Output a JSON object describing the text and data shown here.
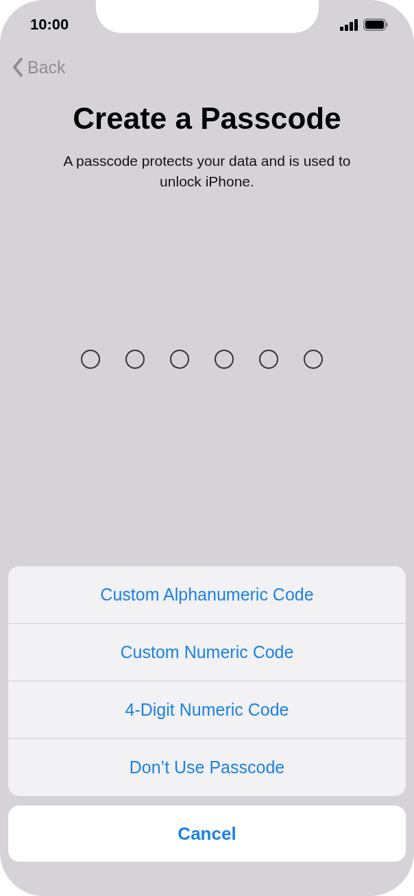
{
  "status_bar": {
    "time": "10:00"
  },
  "navigation": {
    "back": "Back"
  },
  "title": "Create a Passcode",
  "subtitle": "A passcode protects your data and is used to unlock iPhone.",
  "passcode_dots": [
    {
      "filled": false
    },
    {
      "filled": false
    },
    {
      "filled": false
    },
    {
      "filled": false
    },
    {
      "filled": false
    },
    {
      "filled": false
    }
  ],
  "action_sheet": {
    "options": [
      "Custom Alphanumeric Code",
      "Custom Numeric Code",
      "4-Digit Numeric Code",
      "Don’t Use Passcode"
    ],
    "cancel": "Cancel"
  }
}
